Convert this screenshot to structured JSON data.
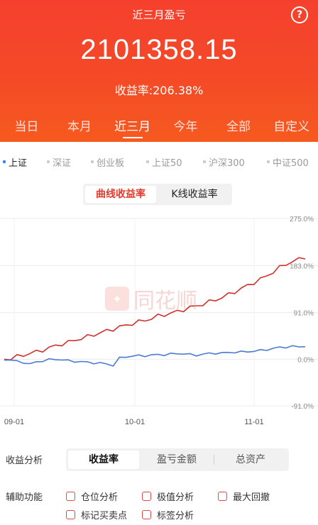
{
  "header": {
    "title": "近三月盈亏",
    "help_icon": "?",
    "amount": "2101358.15",
    "yield_text": "收益率:206.38%"
  },
  "periods": [
    "当日",
    "本月",
    "近三月",
    "今年",
    "全部",
    "自定义"
  ],
  "active_period": "近三月",
  "indices": [
    "上证",
    "深证",
    "创业板",
    "上证50",
    "沪深300",
    "中证500"
  ],
  "active_index": "上证",
  "chart_mode": {
    "options": [
      "曲线收益率",
      "K线收益率"
    ],
    "selected": "曲线收益率"
  },
  "watermark": "同花顺",
  "chart_data": {
    "type": "line",
    "y_ticks": [
      "275.0%",
      "183.0%",
      "91.0%",
      "0.0%",
      "-91.0%"
    ],
    "y_values": [
      275.0,
      183.0,
      91.0,
      0.0,
      -91.0
    ],
    "x_ticks": [
      "09-01",
      "10-01",
      "11-01"
    ],
    "ylim": [
      -91.0,
      275.0
    ],
    "grid": true,
    "series": [
      {
        "color": "#d0312d",
        "values": [
          0,
          2,
          5,
          8,
          12,
          14,
          18,
          22,
          26,
          30,
          33,
          37,
          41,
          44,
          48,
          52,
          55,
          59,
          63,
          66,
          70,
          73,
          76,
          80,
          84,
          87,
          90,
          93,
          97,
          101,
          104,
          108,
          112,
          116,
          121,
          126,
          132,
          138,
          144,
          150,
          156,
          163,
          171,
          179,
          186,
          191,
          195,
          200
        ]
      },
      {
        "color": "#4a7bd4",
        "values": [
          0,
          -2,
          -4,
          -6,
          -10,
          -5,
          -3,
          -1,
          0,
          -1,
          -3,
          -4,
          -5,
          -6,
          -7,
          -8,
          -9,
          -12,
          2,
          5,
          6,
          7,
          7,
          8,
          9,
          9,
          10,
          11,
          11,
          9,
          8,
          10,
          11,
          12,
          12,
          13,
          14,
          14,
          15,
          16,
          17,
          19,
          21,
          23,
          24,
          25,
          24,
          26
        ]
      }
    ]
  },
  "analysis": {
    "label": "收益分析",
    "tabs": [
      "收益率",
      "盈亏金额",
      "总资产"
    ],
    "selected": "收益率"
  },
  "aux": {
    "label": "辅助功能",
    "options": [
      "仓位分析",
      "极值分析",
      "最大回撤",
      "标记买卖点",
      "标签分析"
    ]
  }
}
